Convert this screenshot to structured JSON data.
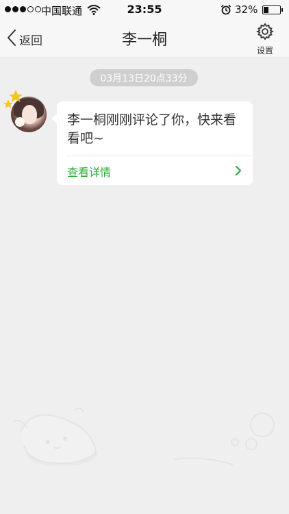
{
  "status_bar": {
    "carrier": "中国联通",
    "time": "23:55",
    "battery_percent_label": "32%",
    "battery_level": 0.32,
    "signal_bars_filled": 3,
    "signal_bars_total": 5
  },
  "nav": {
    "back_label": "返回",
    "title": "李一桐",
    "settings_label": "设置"
  },
  "message": {
    "timestamp": "03月13日20点33分",
    "text": "李一桐刚刚评论了你，快来看看吧~",
    "link_label": "查看详情"
  },
  "colors": {
    "accent_green": "#2aae3a",
    "star_yellow": "#f5c518",
    "background": "#efefef"
  },
  "icons": [
    "back-chevron-icon",
    "gear-icon",
    "wifi-icon",
    "alarm-icon",
    "star-icon",
    "chevron-right-icon"
  ]
}
